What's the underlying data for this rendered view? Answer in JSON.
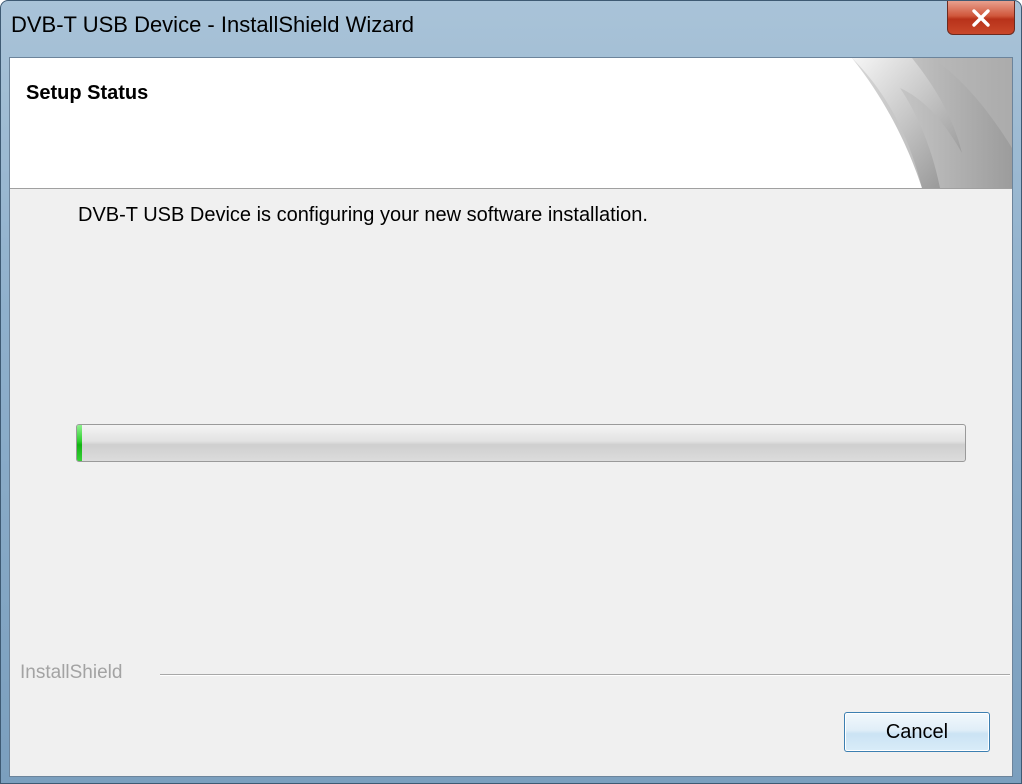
{
  "window": {
    "title": "DVB-T USB Device - InstallShield Wizard"
  },
  "titlebar": {
    "close_icon": "close-icon"
  },
  "header": {
    "title": "Setup Status",
    "graphic_icon": "page-curl-graphic"
  },
  "main": {
    "status_text": "DVB-T USB Device is configuring your new software installation.",
    "progress": {
      "fraction": 0.006,
      "color": "#2fcf2f"
    }
  },
  "footer": {
    "brand": "InstallShield",
    "cancel_label": "Cancel"
  },
  "colors": {
    "accent_close": "#c9472a",
    "progress_green": "#2fcf2f",
    "button_border": "#3c7fb1"
  }
}
